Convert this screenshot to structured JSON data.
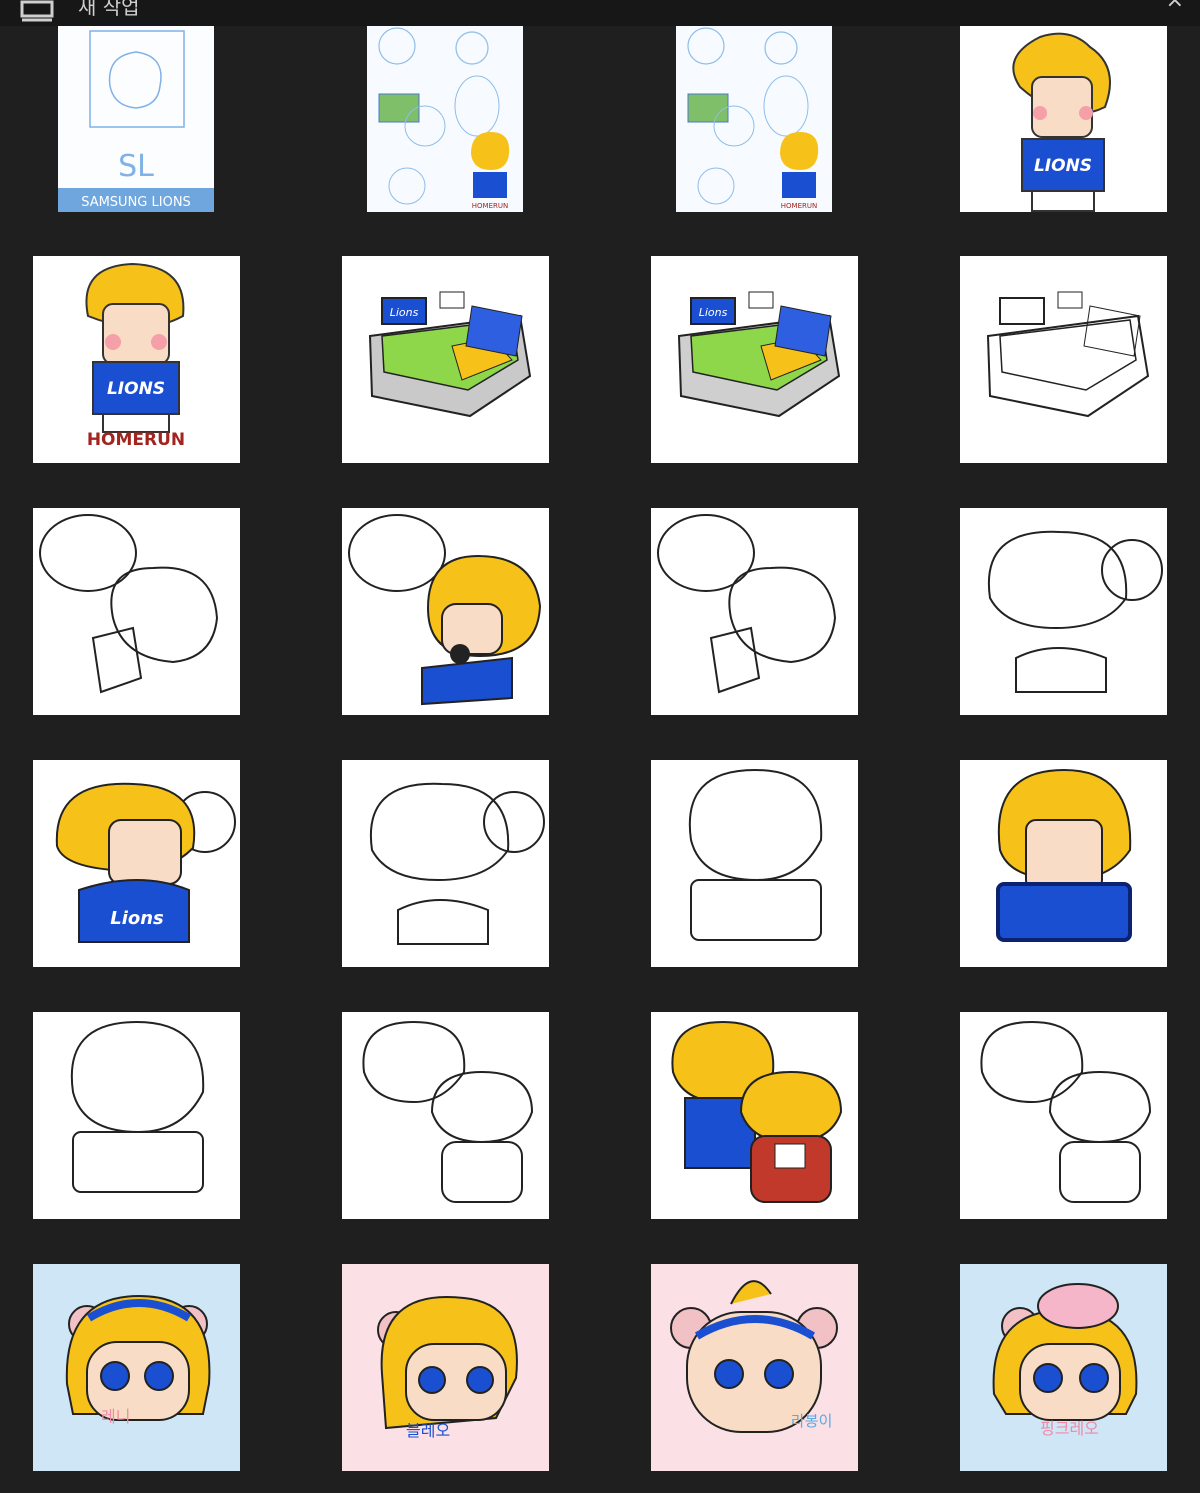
{
  "window": {
    "title": "새 작업",
    "menu_icon": "layers-icon",
    "close_icon": "close-icon"
  },
  "colors": {
    "background": "#1f1f1f",
    "sky": "#cfe6f6",
    "pink": "#fbe0e6",
    "lions_blue": "#1a4fd1",
    "hair_yellow": "#f6c21a",
    "skin": "#f9dcc6",
    "homerun_red": "#a3241e"
  },
  "sketch_card": {
    "club_text": "SAMSUNG LIONS",
    "mark_text": "SL"
  },
  "homerun_text": "HOMERUN",
  "jersey_text": "LIONS",
  "stadium_sign_text": "Lions",
  "character_names": [
    "레니",
    "블레오",
    "라봉이",
    "핑크레오"
  ]
}
